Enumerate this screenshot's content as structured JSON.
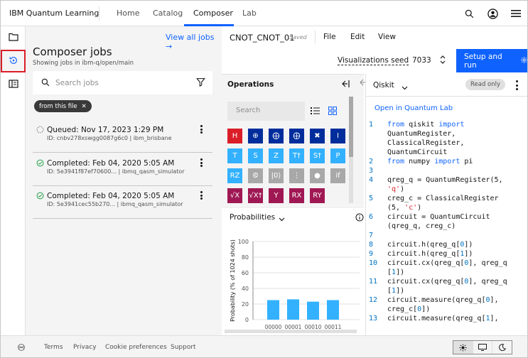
{
  "header": {
    "brand_prefix": "IBM",
    "brand_name": "Quantum Learning",
    "nav": [
      "Home",
      "Catalog",
      "Composer",
      "Lab"
    ],
    "active_nav": "Composer",
    "icons": [
      "search-icon",
      "user-icon",
      "menu-icon"
    ]
  },
  "rail": {
    "items": [
      "folder-icon",
      "composer-jobs-icon",
      "docs-icon"
    ],
    "selected": "composer-jobs-icon"
  },
  "jobs_panel": {
    "view_all": "View all jobs →",
    "title": "Composer jobs",
    "subtitle": "Showing jobs in ibm-q/open/main",
    "search_placeholder": "Search jobs",
    "filter_tag": "from this file",
    "jobs": [
      {
        "status": "Queued: Nov 17, 2023 1:29 PM",
        "id": "ID: cnbv278xswgg0087g6c0 | ibm_brisbane",
        "state": "queued"
      },
      {
        "status": "Completed: Feb 04, 2020 5:05 AM",
        "id": "ID: 5e3941f87ef70600... | ibmq_qasm_simulator",
        "state": "completed"
      },
      {
        "status": "Completed: Feb 04, 2020 5:05 AM",
        "id": "ID: 5e3941cec55b270... | ibmq_qasm_simulator",
        "state": "completed"
      }
    ]
  },
  "composer": {
    "file_name": "CNOT_CNOT_01",
    "saved": "Saved",
    "menu": [
      "File",
      "Edit",
      "View"
    ],
    "viz_seed_label": "Visualizations seed",
    "viz_seed_value": "7033",
    "run_button": "Setup and run"
  },
  "operations": {
    "title": "Operations",
    "search_placeholder": "Search",
    "gates": [
      {
        "label": "H",
        "color": "#da1e28"
      },
      {
        "label": "⊕",
        "color": "#002d9c"
      },
      {
        "label": "⨁",
        "color": "#002d9c"
      },
      {
        "label": "⨁",
        "color": "#002d9c"
      },
      {
        "label": "✖",
        "color": "#002d9c"
      },
      {
        "label": "I",
        "color": "#002d9c"
      },
      {
        "label": "T",
        "color": "#33b1ff"
      },
      {
        "label": "S",
        "color": "#33b1ff"
      },
      {
        "label": "Z",
        "color": "#33b1ff"
      },
      {
        "label": "T†",
        "color": "#33b1ff"
      },
      {
        "label": "S†",
        "color": "#33b1ff"
      },
      {
        "label": "P",
        "color": "#33b1ff"
      },
      {
        "label": "RZ",
        "color": "#33b1ff"
      },
      {
        "label": "⧀",
        "color": "#a8a8a8"
      },
      {
        "label": "|0⟩",
        "color": "#a8a8a8"
      },
      {
        "label": "⋮",
        "color": "#a8a8a8"
      },
      {
        "label": "●",
        "color": "#a8a8a8"
      },
      {
        "label": "if",
        "color": "#a8a8a8"
      },
      {
        "label": "√X",
        "color": "#9f1853"
      },
      {
        "label": "√X†",
        "color": "#9f1853"
      },
      {
        "label": "Y",
        "color": "#9f1853"
      },
      {
        "label": "RX",
        "color": "#9f1853"
      },
      {
        "label": "RY",
        "color": "#9f1853"
      }
    ]
  },
  "probabilities": {
    "title": "Probabilities",
    "chart_data": {
      "type": "bar",
      "ylabel": "Probability (% of 1024 shots)",
      "ylim": [
        0,
        100
      ],
      "yticks": [
        "0",
        "20",
        "40",
        "60",
        "80",
        "100"
      ],
      "categories": [
        "00000",
        "00001",
        "00010",
        "00011"
      ],
      "values": [
        25,
        26,
        23,
        25
      ],
      "bar_color": "#33b1ff"
    }
  },
  "code_panel": {
    "language": "Qiskit",
    "read_only": "Read only",
    "open_lab": "Open in Quantum Lab",
    "lines": [
      {
        "n": "1",
        "text": "from qiskit import"
      },
      {
        "n": "",
        "text": "QuantumRegister,"
      },
      {
        "n": "",
        "text": "ClassicalRegister,"
      },
      {
        "n": "",
        "text": "QuantumCircuit"
      },
      {
        "n": "2",
        "text": "from numpy import pi"
      },
      {
        "n": "3",
        "text": ""
      },
      {
        "n": "4",
        "text": "qreg_q = QuantumRegister(5,"
      },
      {
        "n": "",
        "text": "'q')"
      },
      {
        "n": "5",
        "text": "creg_c = ClassicalRegister"
      },
      {
        "n": "",
        "text": "(5, 'c')"
      },
      {
        "n": "6",
        "text": "circuit = QuantumCircuit"
      },
      {
        "n": "",
        "text": "(qreg_q, creg_c)"
      },
      {
        "n": "7",
        "text": ""
      },
      {
        "n": "8",
        "text": "circuit.h(qreg_q[0])"
      },
      {
        "n": "9",
        "text": "circuit.h(qreg_q[1])"
      },
      {
        "n": "10",
        "text": "circuit.cx(qreg_q[0], qreg_q"
      },
      {
        "n": "",
        "text": "[1])"
      },
      {
        "n": "11",
        "text": "circuit.cx(qreg_q[0], qreg_q"
      },
      {
        "n": "",
        "text": "[1])"
      },
      {
        "n": "12",
        "text": "circuit.measure(qreg_q[0],"
      },
      {
        "n": "",
        "text": "creg_c[0])"
      },
      {
        "n": "13",
        "text": "circuit.measure(qreg_q[1],"
      }
    ]
  },
  "footer": {
    "links": [
      "Terms",
      "Privacy",
      "Cookie preferences",
      "Support"
    ],
    "theme_options": [
      "light-theme-icon",
      "system-theme-icon",
      "dark-theme-icon"
    ]
  }
}
